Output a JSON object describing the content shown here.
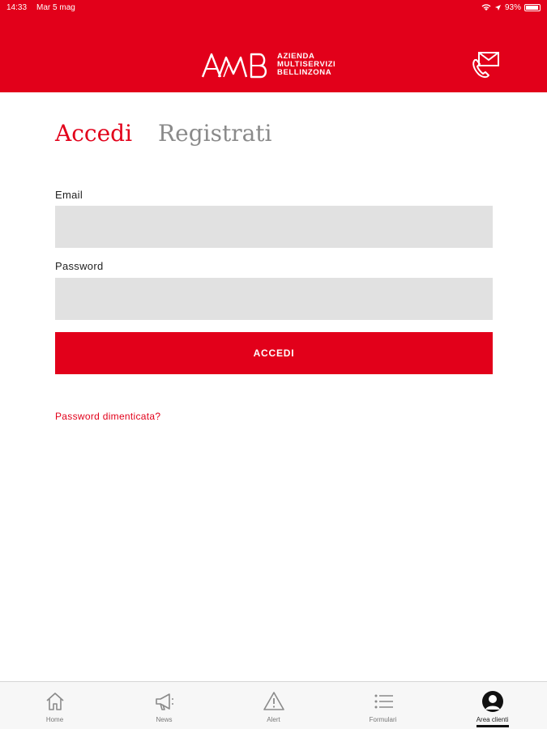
{
  "status_bar": {
    "time": "14:33",
    "date": "Mar 5 mag",
    "battery_percent": "93%",
    "battery_level": 0.93
  },
  "header": {
    "logo_mark": "AMB",
    "logo_lines": [
      "AZIENDA",
      "MULTISERVIZI",
      "BELLINZONA"
    ],
    "contact_icon": "phone-mail-icon",
    "background_color": "#e2001a"
  },
  "tabs": [
    {
      "label": "Accedi",
      "active": true
    },
    {
      "label": "Registrati",
      "active": false
    }
  ],
  "form": {
    "email_label": "Email",
    "email_value": "",
    "email_placeholder": "",
    "password_label": "Password",
    "password_value": "",
    "password_placeholder": "",
    "submit_label": "ACCEDI",
    "forgot_label": "Password dimenticata?"
  },
  "bottom_nav": [
    {
      "label": "Home",
      "icon": "home-icon",
      "active": false
    },
    {
      "label": "News",
      "icon": "megaphone-icon",
      "active": false
    },
    {
      "label": "Alert",
      "icon": "alert-icon",
      "active": false
    },
    {
      "label": "Formulari",
      "icon": "list-icon",
      "active": false
    },
    {
      "label": "Area clienti",
      "icon": "user-icon",
      "active": true
    }
  ],
  "colors": {
    "accent": "#e2001a",
    "input_bg": "#e1e1e1",
    "inactive_tab": "#8a8a8a"
  }
}
